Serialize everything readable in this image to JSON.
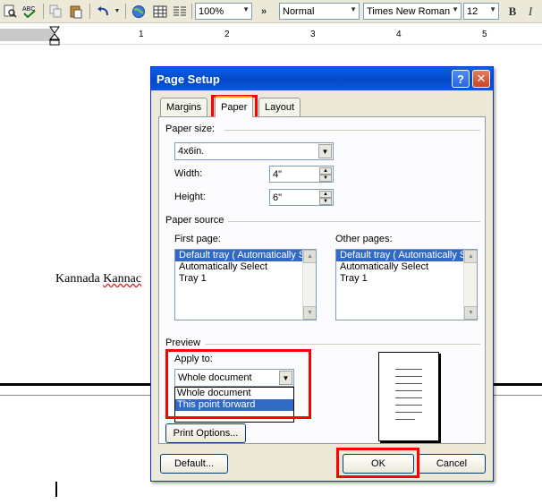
{
  "toolbar": {
    "zoom": "100%",
    "style": "Normal",
    "font": "Times New Roman",
    "size": "12",
    "bold": "B",
    "italic": "I",
    "more": "»"
  },
  "ruler": {
    "numbers": [
      "1",
      "2",
      "3",
      "4",
      "5"
    ]
  },
  "document": {
    "text_plain": "Kannada ",
    "text_squiggle": "Kannac"
  },
  "dialog": {
    "title": "Page Setup",
    "help_icon": "?",
    "close_icon": "✕",
    "tabs": [
      "Margins",
      "Paper",
      "Layout"
    ],
    "active_tab": "Paper",
    "paper_size": {
      "label": "Paper size:",
      "value": "4x6in.",
      "width_label": "Width:",
      "width_value": "4\"",
      "height_label": "Height:",
      "height_value": "6\""
    },
    "paper_source": {
      "label": "Paper source",
      "first_page_label": "First page:",
      "other_pages_label": "Other pages:",
      "first_page_items": [
        "Default tray ( Automatically Select)",
        "Automatically Select",
        "Tray 1"
      ],
      "other_pages_items": [
        "Default tray ( Automatically Select)",
        "Automatically Select",
        "Tray 1"
      ]
    },
    "preview": {
      "label": "Preview",
      "apply_to_label": "Apply to:",
      "apply_to_value": "Whole document",
      "apply_to_options": [
        "Whole document",
        "This point forward"
      ]
    },
    "buttons": {
      "print_options": "Print Options...",
      "default": "Default...",
      "ok": "OK",
      "cancel": "Cancel"
    }
  },
  "colors": {
    "highlight": "#ff0000",
    "selection": "#316ac5",
    "title_bar": "#0348c8"
  }
}
